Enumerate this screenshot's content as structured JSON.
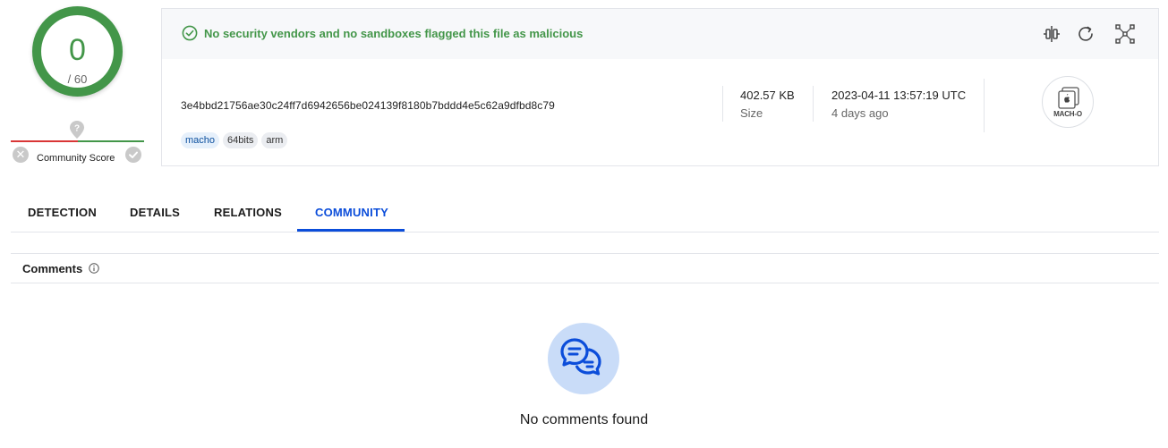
{
  "detection": {
    "score": "0",
    "total": "/ 60"
  },
  "community": {
    "label": "Community Score",
    "negative_symbol": "✕"
  },
  "banner": {
    "text": "No security vendors and no sandboxes flagged this file as malicious"
  },
  "toolbar": {
    "icons": [
      "compare-icon",
      "reanalyze-icon",
      "graph-icon"
    ]
  },
  "file": {
    "hash": "3e4bbd21756ae30c24ff7d6942656be024139f8180b7bddd4e5c62a9dfbd8c79",
    "tags": [
      "macho",
      "64bits",
      "arm"
    ],
    "size_value": "402.57 KB",
    "size_label": "Size",
    "date_value": "2023-04-11 13:57:19 UTC",
    "date_label": "4 days ago",
    "type_label": "MACH-O"
  },
  "tabs": [
    {
      "label": "DETECTION"
    },
    {
      "label": "DETAILS"
    },
    {
      "label": "RELATIONS"
    },
    {
      "label": "COMMUNITY"
    }
  ],
  "active_tab": "COMMUNITY",
  "comments": {
    "title": "Comments",
    "empty_text": "No comments found"
  },
  "colors": {
    "clean_green": "#439649",
    "accent_blue": "#0b4dda",
    "negative_red": "#d93636"
  }
}
